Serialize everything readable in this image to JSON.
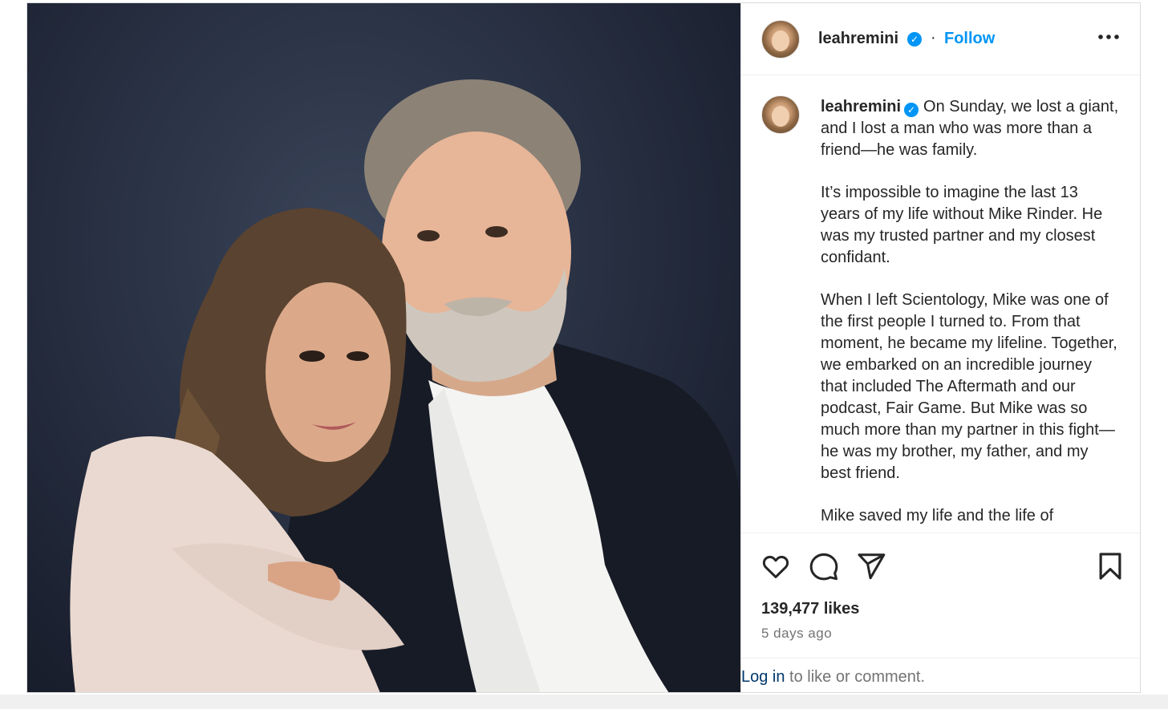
{
  "post": {
    "username": "leahremini",
    "verified_badge": "✓",
    "separator": "·",
    "follow_label": "Follow",
    "more_label": "•••",
    "caption_paragraphs": [
      "On Sunday, we lost a giant, and I lost a man who was more than a friend—he was family.",
      "It’s impossible to imagine the last 13 years of my life without Mike Rinder. He was my trusted partner and my closest confidant.",
      "When I left Scientology, Mike was one of the first people I turned to. From that moment, he became my lifeline. Together, we embarked on an incredible journey that included The Aftermath and our podcast, Fair Game. But Mike was so much more than my partner in this fight—he was my brother, my father, and my best friend.",
      "Mike saved my life and the life of"
    ],
    "likes": "139,477 likes",
    "timestamp": "5 days ago",
    "login_link": "Log in",
    "login_rest": " to like or comment."
  },
  "icons": {
    "like": "heart-icon",
    "comment": "comment-icon",
    "share": "share-icon",
    "save": "bookmark-icon"
  },
  "colors": {
    "accent": "#0095f6",
    "text": "#262626",
    "secondary": "#737373",
    "link": "#00376b"
  }
}
